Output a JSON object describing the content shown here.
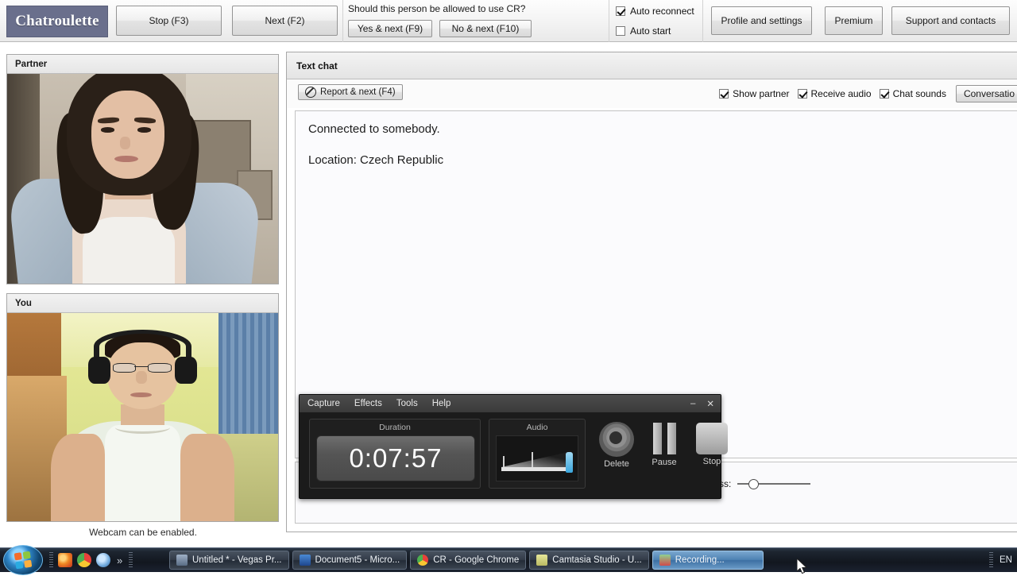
{
  "header": {
    "logo": "Chatroulette",
    "stop_button": "Stop (F3)",
    "next_button": "Next (F2)",
    "cr_question": "Should this person be allowed to use CR?",
    "yes_button": "Yes & next (F9)",
    "no_button": "No & next (F10)",
    "auto_reconnect_label": "Auto reconnect",
    "auto_reconnect_checked": true,
    "auto_start_label": "Auto start",
    "auto_start_checked": false,
    "profile_button": "Profile and settings",
    "premium_button": "Premium",
    "support_button": "Support and contacts",
    "logo_color": "#6a6f8c"
  },
  "left": {
    "partner_title": "Partner",
    "you_title": "You",
    "webcam_note": "Webcam can be enabled."
  },
  "chat": {
    "title": "Text chat",
    "report_button": "Report & next (F4)",
    "report_icon": "ban-icon",
    "show_partner_label": "Show partner",
    "show_partner_checked": true,
    "receive_audio_label": "Receive audio",
    "receive_audio_checked": true,
    "chat_sounds_label": "Chat sounds",
    "chat_sounds_checked": true,
    "conversation_button": "Conversatio",
    "messages": [
      "Connected to somebody.",
      "Location: Czech Republic"
    ],
    "thickness_label": "ickness:"
  },
  "camtasia": {
    "menu": [
      "Capture",
      "Effects",
      "Tools",
      "Help"
    ],
    "minimize": "–",
    "close": "✕",
    "duration_label": "Duration",
    "duration_value": "0:07:57",
    "audio_label": "Audio",
    "delete_label": "Delete",
    "pause_label": "Pause",
    "stop_label": "Stop"
  },
  "taskbar": {
    "start_icon": "windows-orb-icon",
    "quick_launch": [
      {
        "name": "firefox-icon",
        "color": "#e8792b"
      },
      {
        "name": "chrome-icon",
        "color": "#d94235"
      },
      {
        "name": "media-player-icon",
        "color": "#6fa8dc"
      }
    ],
    "overflow_chevron": "»",
    "tasks": [
      {
        "label": "Untitled * - Vegas Pr...",
        "icon": "vegas-pro-icon",
        "color": "#7b8aa0",
        "active": false
      },
      {
        "label": "Document5 - Micro...",
        "icon": "word-icon",
        "color": "#2b5797",
        "active": false
      },
      {
        "label": "CR - Google Chrome",
        "icon": "chrome-icon",
        "color": "#d94235",
        "active": false
      },
      {
        "label": "Camtasia Studio - U...",
        "icon": "camtasia-icon",
        "color": "#d9d98a",
        "active": false
      },
      {
        "label": "Recording...",
        "icon": "camtasia-recorder-icon",
        "color": "#4a9e4a",
        "active": true
      }
    ],
    "language": "EN"
  }
}
